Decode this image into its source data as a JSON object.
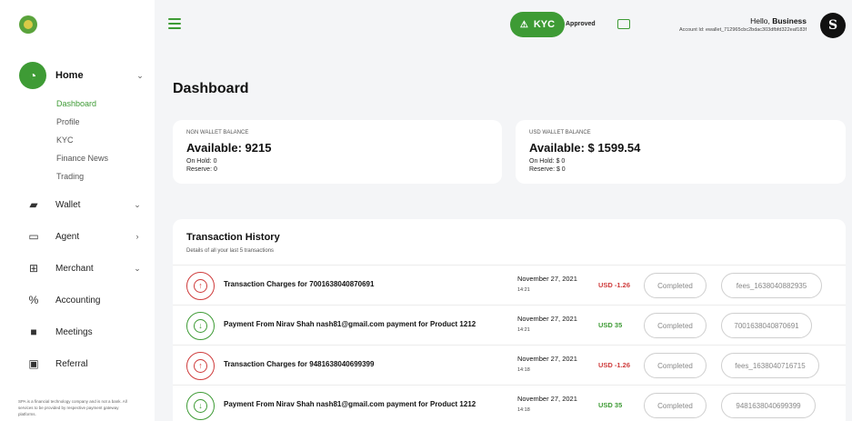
{
  "header": {
    "kyc_label": "KYC",
    "kyc_status": "Approved",
    "greeting_prefix": "Hello, ",
    "user_name": "Business",
    "account_id": "Account Id: ewallet_712965cbc2bdac303dfbfd322eaf183f",
    "avatar_text": "S"
  },
  "sidebar": {
    "home_label": "Home",
    "sub_items": [
      "Dashboard",
      "Profile",
      "KYC",
      "Finance News",
      "Trading"
    ],
    "items": [
      {
        "label": "Wallet",
        "icon": "briefcase-icon"
      },
      {
        "label": "Agent",
        "icon": "money-icon"
      },
      {
        "label": "Merchant",
        "icon": "cart-icon"
      },
      {
        "label": "Accounting",
        "icon": "percent-icon"
      },
      {
        "label": "Meetings",
        "icon": "video-icon"
      },
      {
        "label": "Referral",
        "icon": "gift-icon"
      }
    ],
    "footer_note": "SPA is a financial technology company and is not a bank. All services to be provided by respective payment gateway platforms."
  },
  "page": {
    "title": "Dashboard"
  },
  "wallets": {
    "ngn": {
      "label": "NGN WALLET BALANCE",
      "available": "Available:  9215",
      "on_hold": "On Hold:  0",
      "reserve": "Reserve:  0"
    },
    "usd": {
      "label": "USD WALLET BALANCE",
      "available": "Available: $ 1599.54",
      "on_hold": "On Hold: $ 0",
      "reserve": "Reserve: $ 0"
    }
  },
  "transactions": {
    "title": "Transaction History",
    "subtitle": "Details of all your last 5 transactions",
    "rows": [
      {
        "direction": "out",
        "description": "Transaction Charges for 7001638040870691",
        "date": "November 27, 2021",
        "time": "14:21",
        "amount": "USD -1.26",
        "status": "Completed",
        "reference": "fees_1638040882935"
      },
      {
        "direction": "in",
        "description": "Payment From Nirav Shah nash81@gmail.com payment for Product 1212",
        "date": "November 27, 2021",
        "time": "14:21",
        "amount": "USD 35",
        "status": "Completed",
        "reference": "7001638040870691"
      },
      {
        "direction": "out",
        "description": "Transaction Charges for 9481638040699399",
        "date": "November 27, 2021",
        "time": "14:18",
        "amount": "USD -1.26",
        "status": "Completed",
        "reference": "fees_1638040716715"
      },
      {
        "direction": "in",
        "description": "Payment From Nirav Shah nash81@gmail.com payment for Product 1212",
        "date": "November 27, 2021",
        "time": "14:18",
        "amount": "USD 35",
        "status": "Completed",
        "reference": "9481638040699399"
      }
    ]
  },
  "colors": {
    "accent": "#3e9b35",
    "negative": "#cf3b3b"
  }
}
